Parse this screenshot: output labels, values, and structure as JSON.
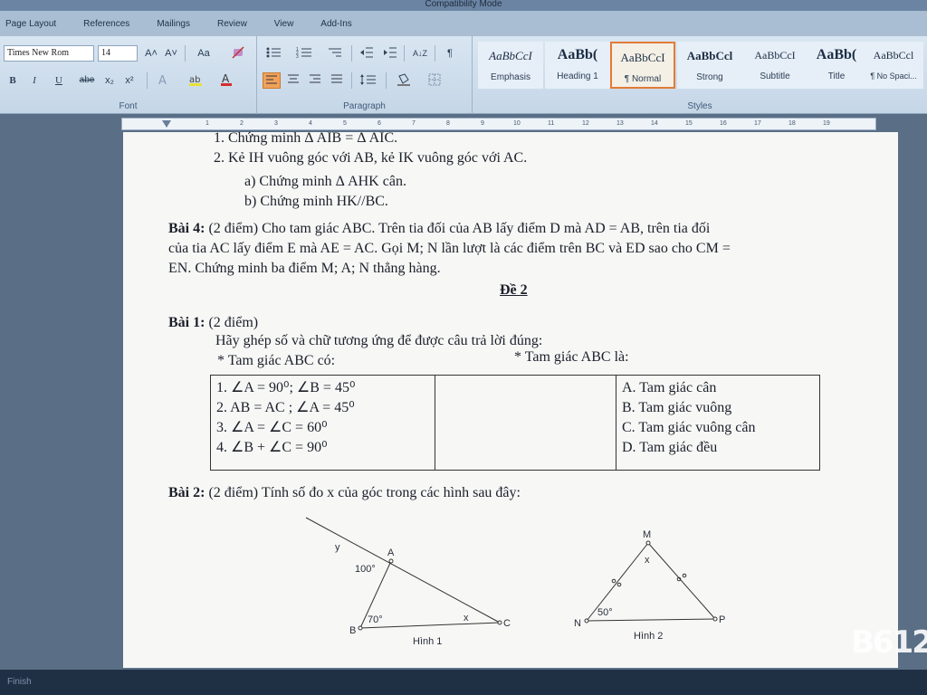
{
  "window": {
    "title": "Compatibility Mode"
  },
  "ribbon": {
    "tabs": [
      "Page Layout",
      "References",
      "Mailings",
      "Review",
      "View",
      "Add-Ins"
    ],
    "font": {
      "name": "Times New Rom",
      "size": "14",
      "label": "Font",
      "buttons": {
        "bold": "B",
        "italic": "I",
        "underline": "U",
        "strike": "abe",
        "subscript": "x₂",
        "superscript": "x²",
        "grow": "A˄",
        "shrink": "A˅",
        "change_case": "Aa"
      }
    },
    "paragraph": {
      "label": "Paragraph",
      "sort": "A↓Z",
      "pilcrow": "¶"
    },
    "styles": {
      "label": "Styles",
      "items": [
        {
          "sample": "AaBbCcI",
          "name": "Emphasis"
        },
        {
          "sample": "AaBb(",
          "name": "Heading 1"
        },
        {
          "sample": "AaBbCcI",
          "name": "¶ Normal"
        },
        {
          "sample": "AaBbCcl",
          "name": "Strong"
        },
        {
          "sample": "AaBbCcI",
          "name": "Subtitle"
        },
        {
          "sample": "AaBb(",
          "name": "Title"
        },
        {
          "sample": "AaBbCcl",
          "name": "¶ No Spaci..."
        }
      ]
    }
  },
  "ruler": {
    "ticks": [
      "1",
      "2",
      "3",
      "4",
      "5",
      "6",
      "7",
      "8",
      "9",
      "10",
      "11",
      "12",
      "13",
      "14",
      "15",
      "16",
      "17",
      "18",
      "19"
    ]
  },
  "document": {
    "line0": "1.  Chứng minh Δ AIB = Δ AIC.",
    "line1": "2.  Kẻ IH vuông góc với AB, kẻ IK vuông góc với AC.",
    "line2": "a)  Chứng minh Δ AHK cân.",
    "line3": "b)  Chứng minh HK//BC.",
    "bai4_label": "Bài 4:",
    "bai4_l1": " (2 điểm) Cho tam giác ABC. Trên tia đối của AB lấy điểm D mà  AD = AB, trên tia đối",
    "bai4_l2": "của tia AC lấy điểm E mà AE = AC. Gọi M; N lần lượt là các điểm trên BC và ED sao cho CM =",
    "bai4_l3": "EN. Chứng minh ba điểm M; A; N thẳng hàng.",
    "de2": "Đề 2",
    "bai1_label": "Bài 1:",
    "bai1_points": " (2 điểm)",
    "bai1_task": "Hãy ghép số và chữ tương ứng để được câu trả lời đúng:",
    "bai1_left_head": "* Tam giác ABC có:",
    "bai1_right_head": "* Tam giác ABC là:",
    "table_left": [
      "1. ∠A = 90⁰;  ∠B = 45⁰",
      "2. AB = AC ;  ∠A = 45⁰",
      "3. ∠A = ∠C = 60⁰",
      "4. ∠B + ∠C = 90⁰"
    ],
    "table_right": [
      "A. Tam giác cân",
      "B. Tam giác vuông",
      "C. Tam giác vuông cân",
      "D. Tam giác đều"
    ],
    "bai2_label": "Bài 2:",
    "bai2_text": " (2 điểm) Tính số đo x của góc trong các hình sau đây:",
    "fig1": {
      "y": "y",
      "A": "A",
      "B": "B",
      "C": "C",
      "angle_A": "100°",
      "angle_B": "70°",
      "x": "x",
      "caption": "Hình 1"
    },
    "fig2": {
      "M": "M",
      "N": "N",
      "P": "P",
      "angle_N": "50°",
      "x": "x",
      "caption": "Hình 2"
    }
  },
  "status": {
    "text": "Finish"
  },
  "watermark": "B612",
  "colors": {
    "ribbon": "#c5d6e7",
    "active_style_border": "#e27b36",
    "page": "#f7f8f6",
    "status_bar": "#1f2f44"
  }
}
